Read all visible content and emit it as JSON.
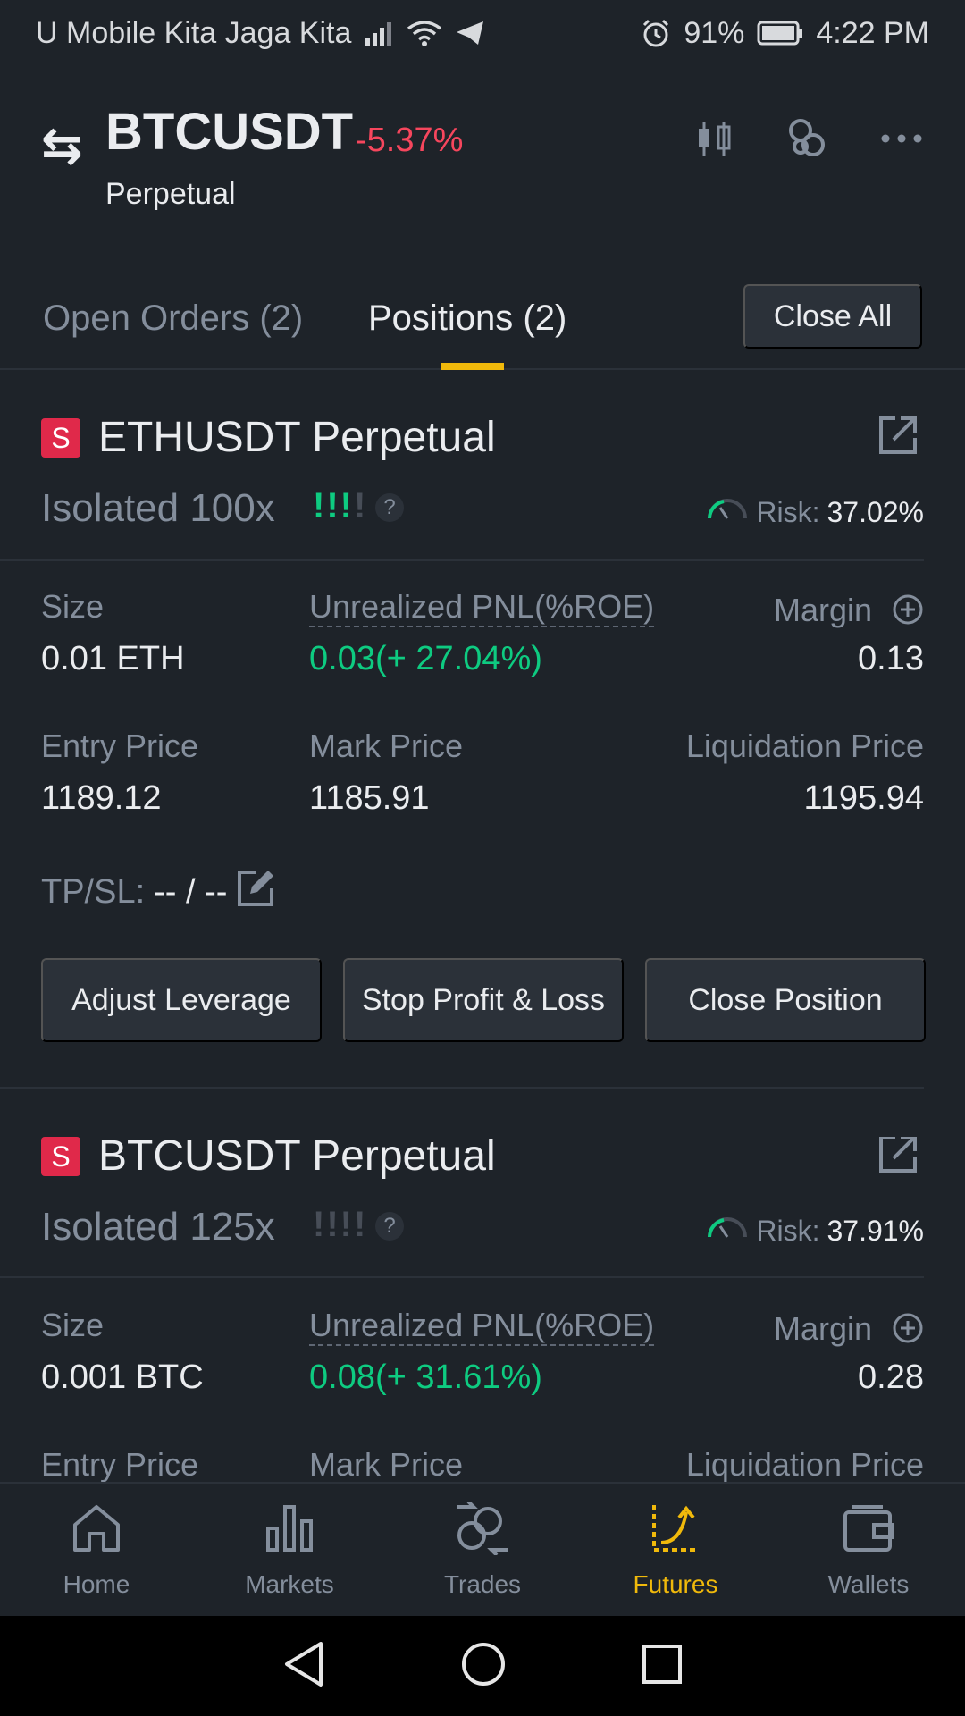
{
  "status_bar": {
    "carrier": "U Mobile Kita Jaga Kita",
    "battery": "91%",
    "time": "4:22 PM"
  },
  "header": {
    "symbol": "BTCUSDT",
    "change": "-5.37%",
    "subtitle": "Perpetual",
    "change_color": "#f6465d"
  },
  "tabs": {
    "open_orders": "Open Orders (2)",
    "positions": "Positions (2)",
    "close_all": "Close All"
  },
  "positions": [
    {
      "badge": "S",
      "pair": "ETHUSDT Perpetual",
      "margin_type": "Isolated 100x",
      "bars": "!!!!",
      "question": "?",
      "risk_label": "Risk:",
      "risk_value": "37.02%",
      "size_label": "Size",
      "size_value": "0.01 ETH",
      "pnl_label": "Unrealized PNL(%ROE)",
      "pnl_value": "0.03(+ 27.04%)",
      "margin_label": "Margin",
      "margin_value": "0.13",
      "entry_label": "Entry Price",
      "entry_value": "1189.12",
      "mark_label": "Mark Price",
      "mark_value": "1185.91",
      "liq_label": "Liquidation Price",
      "liq_value": "1195.94",
      "tpsl_label": "TP/SL:",
      "tpsl_value": "-- / --",
      "buttons": {
        "adjust_leverage": "Adjust Leverage",
        "stop_profit_loss": "Stop Profit & Loss",
        "close_position": "Close Position"
      }
    },
    {
      "badge": "S",
      "pair": "BTCUSDT Perpetual",
      "margin_type": "Isolated 125x",
      "bars": "!!!!",
      "question": "?",
      "risk_label": "Risk:",
      "risk_value": "37.91%",
      "size_label": "Size",
      "size_value": "0.001 BTC",
      "pnl_label": "Unrealized PNL(%ROE)",
      "pnl_value": "0.08(+ 31.61%)",
      "margin_label": "Margin",
      "margin_value": "0.28",
      "entry_label": "Entry Price",
      "mark_label": "Mark Price",
      "liq_label": "Liquidation Price"
    }
  ],
  "bottom_nav": [
    {
      "label": "Home",
      "icon": "home-icon"
    },
    {
      "label": "Markets",
      "icon": "bar-chart-icon"
    },
    {
      "label": "Trades",
      "icon": "trades-icon"
    },
    {
      "label": "Futures",
      "icon": "futures-icon",
      "active": true
    },
    {
      "label": "Wallets",
      "icon": "wallet-icon"
    }
  ],
  "colors": {
    "background": "#1e2329",
    "accent": "#f0b90b",
    "positive": "#0ecb81",
    "negative": "#f6465d",
    "muted": "#848e9c"
  }
}
